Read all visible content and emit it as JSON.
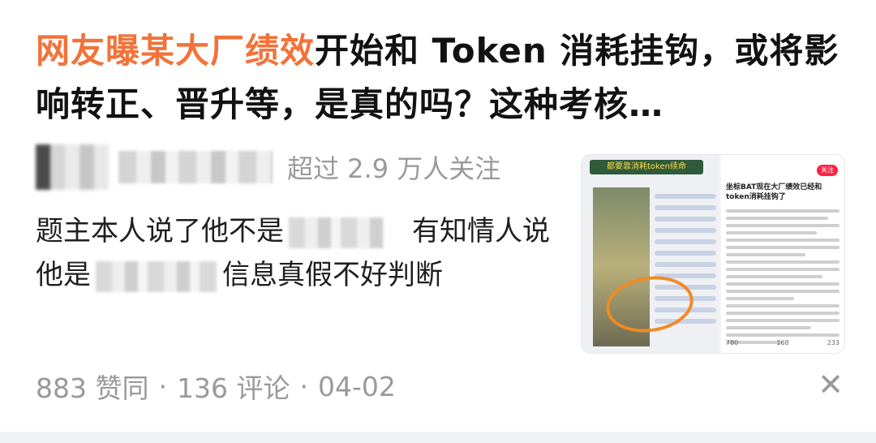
{
  "post": {
    "title_highlight": "网友曝某大厂绩效",
    "title_rest": "开始和 Token 消耗挂钩，或将影响转正、晋升等，是真的吗？这种考核…",
    "followers": "超过 2.9 万人关注",
    "excerpt_part1": "题主本人说了他不是",
    "excerpt_part2": "有知情人说他是",
    "excerpt_part3": "信息真假不好判断"
  },
  "thumbnail": {
    "banner": "都要靠消耗token续命",
    "title": "坐标BAT现在大厂绩效已经和token消耗挂钩了",
    "follow_label": "关注",
    "stats": [
      "780",
      "168",
      "233"
    ]
  },
  "footer": {
    "likes": "883 赞同",
    "comments": "136 评论",
    "date": "04-02",
    "separator": "·",
    "close_glyph": "✕"
  },
  "colors": {
    "highlight": "#f1733a",
    "text": "#121212",
    "muted": "#999999"
  }
}
